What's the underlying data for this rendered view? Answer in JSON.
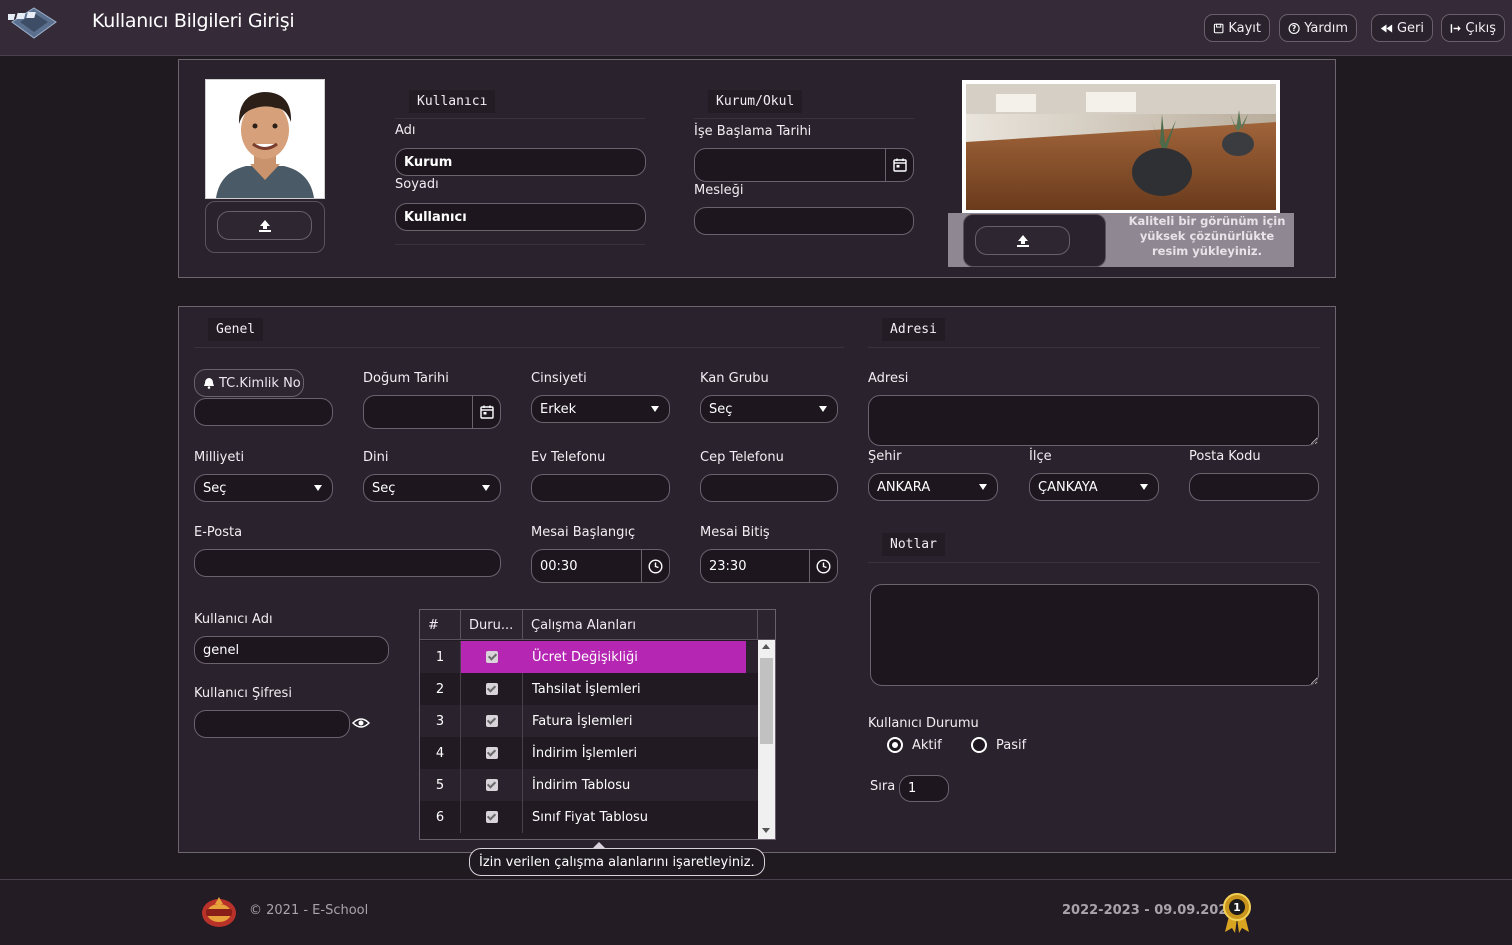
{
  "header": {
    "title": "Kullanıcı Bilgileri Girişi",
    "buttons": {
      "save": "Kayıt",
      "help": "Yardım",
      "back": "Geri",
      "exit": "Çıkış"
    }
  },
  "profile": {
    "user_section": "Kullanıcı",
    "first_name_label": "Adı",
    "first_name_value": "Kurum",
    "last_name_label": "Soyadı",
    "last_name_value": "Kullanıcı",
    "org_section": "Kurum/Okul",
    "start_date_label": "İşe Başlama Tarihi",
    "start_date_value": "",
    "profession_label": "Mesleği",
    "profession_value": "",
    "cover_hint": "Kaliteli bir görünüm için yüksek çözünürlükte resim yükleyiniz."
  },
  "general": {
    "section_title": "Genel",
    "tc_label": "TC.Kimlik No",
    "tc_value": "",
    "birth_date_label": "Doğum Tarihi",
    "birth_date_value": "",
    "gender_label": "Cinsiyeti",
    "gender_value": "Erkek",
    "blood_label": "Kan Grubu",
    "blood_value": "Seç",
    "nationality_label": "Milliyeti",
    "nationality_value": "Seç",
    "religion_label": "Dini",
    "religion_value": "Seç",
    "home_phone_label": "Ev Telefonu",
    "home_phone_value": "",
    "mobile_label": "Cep Telefonu",
    "mobile_value": "",
    "email_label": "E-Posta",
    "email_value": "",
    "work_start_label": "Mesai Başlangıç",
    "work_start_value": "00:30",
    "work_end_label": "Mesai Bitiş",
    "work_end_value": "23:30",
    "username_label": "Kullanıcı Adı",
    "username_value": "genel",
    "password_label": "Kullanıcı Şifresi",
    "password_value": ""
  },
  "grid": {
    "headers": [
      "#",
      "Duru...",
      "Çalışma Alanları"
    ],
    "rows": [
      {
        "num": "1",
        "area": "Ücret Değişikliği",
        "checked": true
      },
      {
        "num": "2",
        "area": "Tahsilat İşlemleri",
        "checked": true
      },
      {
        "num": "3",
        "area": "Fatura İşlemleri",
        "checked": true
      },
      {
        "num": "4",
        "area": "İndirim İşlemleri",
        "checked": true
      },
      {
        "num": "5",
        "area": "İndirim Tablosu",
        "checked": true
      },
      {
        "num": "6",
        "area": "Sınıf Fiyat Tablosu",
        "checked": true
      }
    ],
    "tooltip": "İzin verilen çalışma alanlarını işaretleyiniz."
  },
  "address": {
    "section_title": "Adresi",
    "address_label": "Adresi",
    "address_value": "",
    "city_label": "Şehir",
    "city_value": "ANKARA",
    "district_label": "İlçe",
    "district_value": "ÇANKAYA",
    "postal_label": "Posta Kodu",
    "postal_value": ""
  },
  "notes": {
    "section_title": "Notlar",
    "value": ""
  },
  "status": {
    "label": "Kullanıcı Durumu",
    "active_label": "Aktif",
    "passive_label": "Pasif",
    "selected": "Aktif",
    "order_label": "Sıra",
    "order_value": "1"
  },
  "footer": {
    "copyright": "© 2021 - E-School",
    "term": "2022-2023 - 09.09.2022"
  },
  "colors": {
    "accent": "#b527b3",
    "background": "#1e1a20",
    "panel": "#2a222c"
  }
}
